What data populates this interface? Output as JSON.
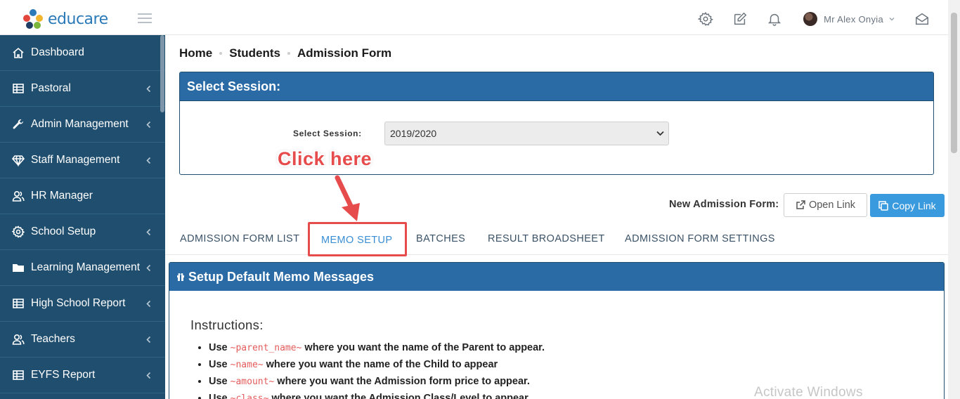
{
  "app": {
    "logo_text": "educare",
    "brand_color": "#2a7ab8",
    "sidebar_color": "#1f4e6f",
    "panel_header_color": "#2a6aa5",
    "accent_color": "#3a9ade"
  },
  "header": {
    "icons": [
      "gear-icon",
      "edit-icon",
      "bell-icon",
      "envelope-icon"
    ],
    "user_name": "Mr Alex Onyia"
  },
  "sidebar": {
    "items": [
      {
        "label": "Dashboard",
        "icon": "home-icon",
        "has_chevron": false
      },
      {
        "label": "Pastoral",
        "icon": "table-icon",
        "has_chevron": true
      },
      {
        "label": "Admin Management",
        "icon": "wrench-icon",
        "has_chevron": true
      },
      {
        "label": "Staff Management",
        "icon": "diamond-icon",
        "has_chevron": true
      },
      {
        "label": "HR Manager",
        "icon": "users-icon",
        "has_chevron": false
      },
      {
        "label": "School Setup",
        "icon": "cog-icon",
        "has_chevron": true
      },
      {
        "label": "Learning Management",
        "icon": "folder-icon",
        "has_chevron": true
      },
      {
        "label": "High School Report",
        "icon": "table-icon",
        "has_chevron": true
      },
      {
        "label": "Teachers",
        "icon": "users-icon",
        "has_chevron": true
      },
      {
        "label": "EYFS Report",
        "icon": "table-icon",
        "has_chevron": true
      }
    ]
  },
  "breadcrumb": [
    "Home",
    "Students",
    "Admission Form"
  ],
  "session_panel": {
    "title": "Select Session:",
    "field_label": "Select Session:",
    "selected_value": "2019/2020"
  },
  "new_admission": {
    "label": "New Admission Form:",
    "open_link": "Open Link",
    "copy_link": "Copy Link"
  },
  "tabs": [
    {
      "label": "ADMISSION FORM LIST",
      "active": false
    },
    {
      "label": "MEMO SETUP",
      "active": true
    },
    {
      "label": "BATCHES",
      "active": false
    },
    {
      "label": "RESULT BROADSHEET",
      "active": false
    },
    {
      "label": "ADMISSION FORM SETTINGS",
      "active": false
    }
  ],
  "memo_panel": {
    "title": "Setup Default Memo Messages",
    "instructions_title": "Instructions:",
    "instructions": [
      {
        "use": "Use",
        "code": "~parent_name~",
        "desc": "where you want the name of the Parent to appear."
      },
      {
        "use": "Use",
        "code": "~name~",
        "desc": "where you want the name of the Child to appear"
      },
      {
        "use": "Use",
        "code": "~amount~",
        "desc": "where you want the Admission form price to appear."
      },
      {
        "use": "Use",
        "code": "~class~",
        "desc": "where you want the Admission Class/Level to appear"
      }
    ]
  },
  "annotation": {
    "callout_text": "Click here",
    "color": "#e74c4c"
  },
  "watermark": "Activate Windows"
}
